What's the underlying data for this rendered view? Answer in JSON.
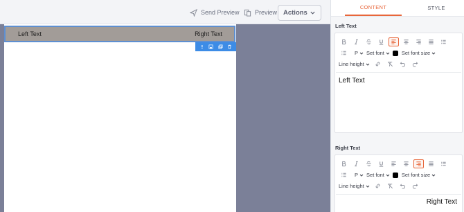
{
  "topbar": {
    "send_preview_label": "Send Preview",
    "preview_label": "Preview",
    "actions_label": "Actions"
  },
  "canvas": {
    "row": {
      "left_text": "Left Text",
      "right_text": "Right Text"
    }
  },
  "panel": {
    "tabs": [
      {
        "label": "CONTENT",
        "active": true
      },
      {
        "label": "STYLE",
        "active": false
      }
    ],
    "left_section": {
      "title": "Left Text",
      "block_type": "P",
      "font": "Set font",
      "font_size": "Set font size",
      "line_height": "Line height",
      "content": "Left Text",
      "alignment": "left"
    },
    "right_section": {
      "title": "Right Text",
      "block_type": "P",
      "font": "Set font",
      "font_size": "Set font size",
      "line_height": "Line height",
      "content": "Right Text",
      "alignment": "right"
    }
  },
  "colors": {
    "accent": "#e8663a",
    "selection_blue": "#3d8ce6",
    "row_bg": "#a29c98",
    "workspace_bg": "#7b8098"
  }
}
